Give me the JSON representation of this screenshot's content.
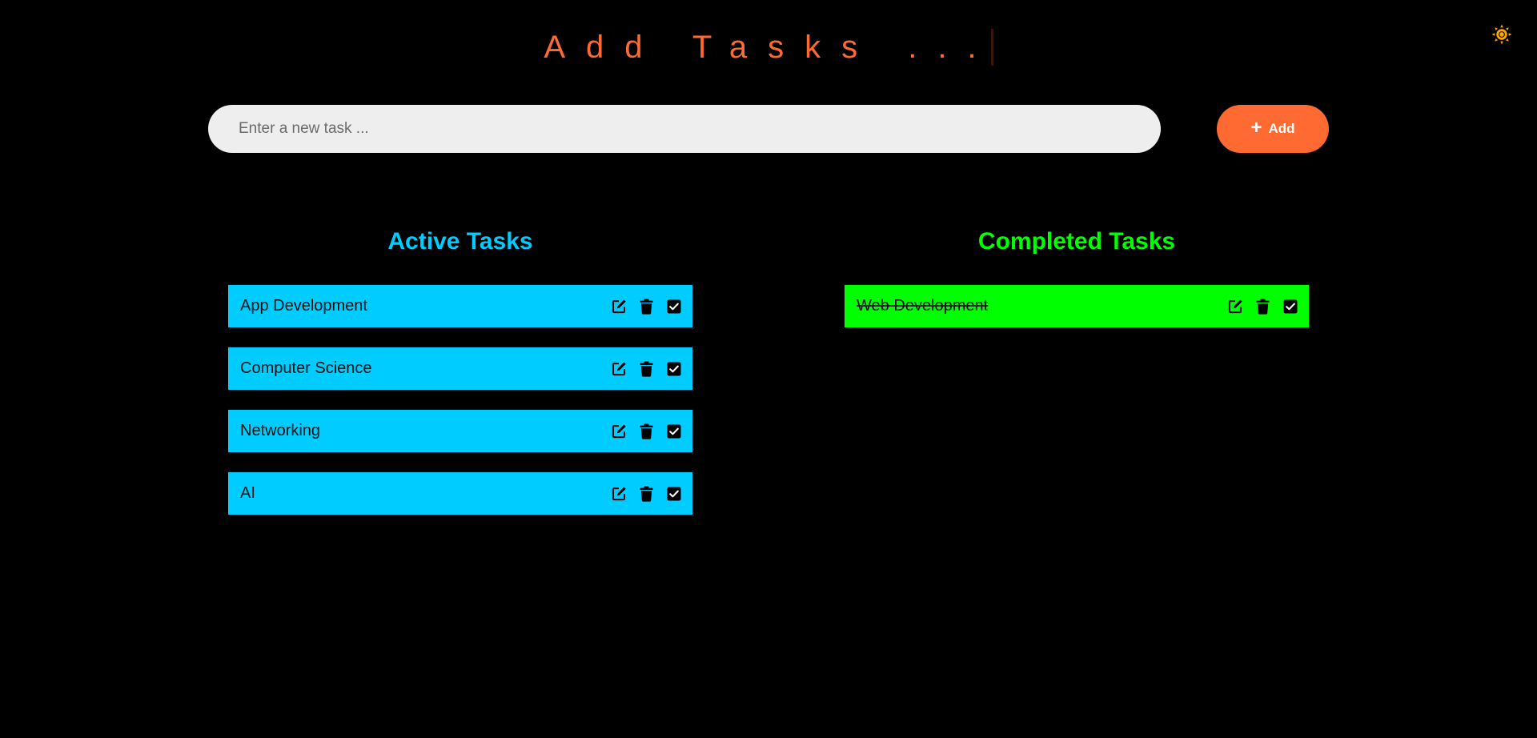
{
  "header": {
    "title": "Add Tasks ..."
  },
  "theme_toggle": {
    "icon": "sun-icon",
    "color": "#ffa500"
  },
  "new_task": {
    "placeholder": "Enter a new task ...",
    "value": "",
    "add_button_label": "Add",
    "add_icon": "plus-icon"
  },
  "active": {
    "heading": "Active Tasks",
    "color": "#00ccff",
    "tasks": [
      {
        "label": "App Development"
      },
      {
        "label": "Computer Science"
      },
      {
        "label": "Networking"
      },
      {
        "label": "AI"
      }
    ]
  },
  "completed": {
    "heading": "Completed Tasks",
    "color": "#00ff00",
    "tasks": [
      {
        "label": "Web Development"
      }
    ]
  },
  "task_actions": [
    "edit-icon",
    "trash-icon",
    "check-square-icon"
  ],
  "colors": {
    "accent": "#ff6a33",
    "background": "#000000",
    "input_background": "#eeeeee"
  }
}
